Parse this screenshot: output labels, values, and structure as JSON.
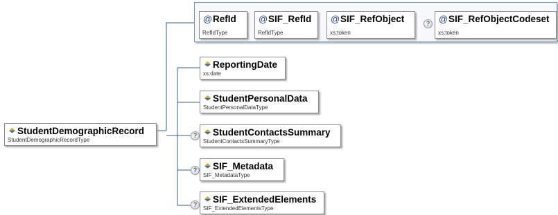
{
  "attributes": [
    {
      "name": "RefId",
      "type": "RefIdType",
      "optional": false
    },
    {
      "name": "SIF_RefId",
      "type": "RefIdType",
      "optional": false
    },
    {
      "name": "SIF_RefObject",
      "type": "xs:token",
      "optional": false
    },
    {
      "name": "SIF_RefObjectCodeset",
      "type": "xs:token",
      "optional": true
    }
  ],
  "root": {
    "name": "StudentDemographicRecord",
    "type": "StudentDemographicRecordType"
  },
  "elements": [
    {
      "name": "ReportingDate",
      "type": "xs:date",
      "optional": false
    },
    {
      "name": "StudentPersonalData",
      "type": "StudentPersonalDataType",
      "optional": false
    },
    {
      "name": "StudentContactsSummary",
      "type": "StudentContactsSummaryType",
      "optional": true
    },
    {
      "name": "SIF_Metadata",
      "type": "SIF_MetadataType",
      "optional": true
    },
    {
      "name": "SIF_ExtendedElements",
      "type": "SIF_ExtendedElementsType",
      "optional": true
    }
  ],
  "icons": {
    "attribute": "at-icon",
    "element": "element-icon",
    "optional": "question-icon"
  },
  "colors": {
    "connector": "#2f5f8f",
    "attribute_group_border": "#7d93ad",
    "element_icon_top": "#e0a020",
    "element_icon_bottom": "#2f6fb0"
  }
}
